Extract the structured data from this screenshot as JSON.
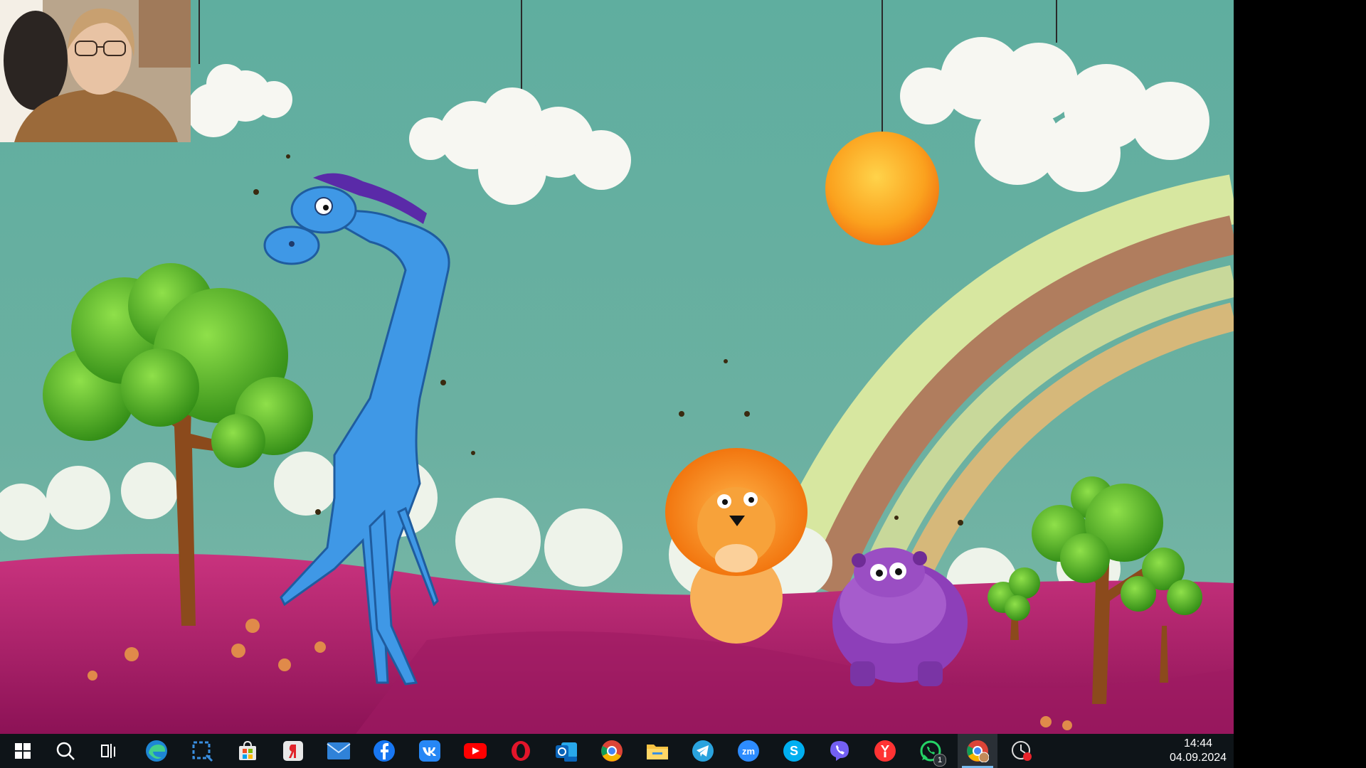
{
  "taskbar": {
    "items": [
      {
        "name": "Start",
        "icon": "windows-start-icon"
      },
      {
        "name": "Search",
        "icon": "search-icon"
      },
      {
        "name": "Task View",
        "icon": "task-view-icon"
      },
      {
        "name": "Microsoft Edge",
        "icon": "edge-icon"
      },
      {
        "name": "Snipping Tool",
        "icon": "snipping-tool-icon"
      },
      {
        "name": "Microsoft Store",
        "icon": "store-icon"
      },
      {
        "name": "Yandex",
        "icon": "yandex-icon"
      },
      {
        "name": "Mail",
        "icon": "mail-icon"
      },
      {
        "name": "Facebook",
        "icon": "facebook-icon"
      },
      {
        "name": "VK",
        "icon": "vk-icon"
      },
      {
        "name": "YouTube",
        "icon": "youtube-icon"
      },
      {
        "name": "Opera",
        "icon": "opera-icon"
      },
      {
        "name": "Outlook (new)",
        "icon": "outlook-icon"
      },
      {
        "name": "Google Chrome",
        "icon": "chrome-icon"
      },
      {
        "name": "File Explorer",
        "icon": "file-explorer-icon"
      },
      {
        "name": "Telegram",
        "icon": "telegram-icon"
      },
      {
        "name": "Zoom",
        "icon": "zoom-icon"
      },
      {
        "name": "Skype",
        "icon": "skype-icon"
      },
      {
        "name": "Viber",
        "icon": "viber-icon"
      },
      {
        "name": "Yandex Browser",
        "icon": "yandex-browser-icon"
      },
      {
        "name": "WhatsApp",
        "icon": "whatsapp-icon",
        "badge": "1"
      },
      {
        "name": "Chrome (profile)",
        "icon": "chrome-profile-icon",
        "active": true
      },
      {
        "name": "Screen Recorder",
        "icon": "recorder-icon"
      }
    ],
    "clock": {
      "time": "14:44",
      "date": "04.09.2024"
    }
  },
  "colors": {
    "taskbar_bg": "#0e1418",
    "sky": "#5aa89a",
    "hill": "#b01e6e",
    "accent": "#76b9ed"
  }
}
